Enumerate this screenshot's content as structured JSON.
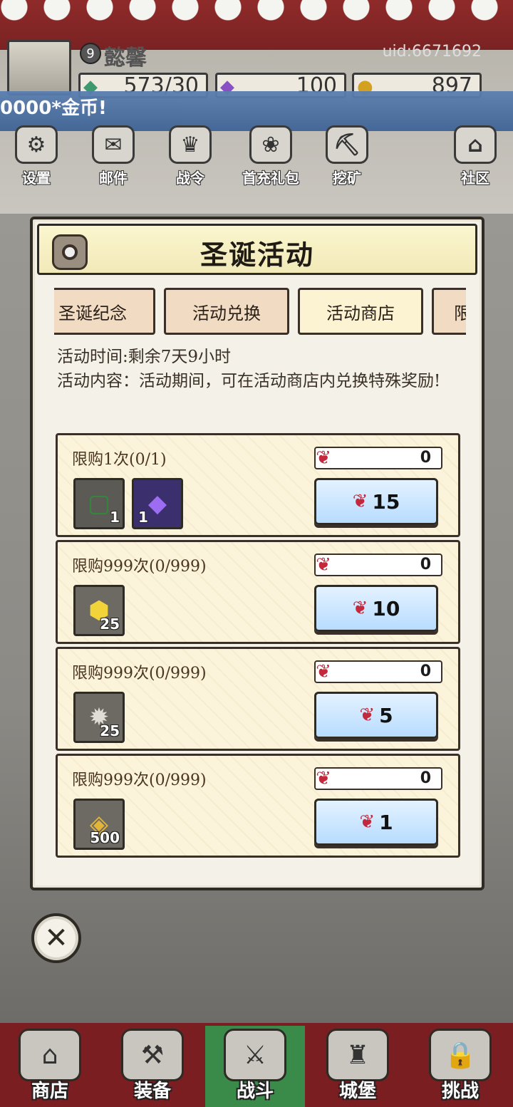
{
  "header": {
    "level": "9",
    "player_name": "懿馨",
    "uid": "uid:6671692",
    "resources": [
      {
        "icon": "green-gem-icon",
        "value": "573/30"
      },
      {
        "icon": "purple-diamond-icon",
        "value": "100"
      },
      {
        "icon": "gold-coin-icon",
        "value": "897"
      }
    ],
    "marquee": "0000*金币!"
  },
  "top_menu": [
    {
      "icon": "gear-icon",
      "label": "设置",
      "glyph": "⚙"
    },
    {
      "icon": "mail-icon",
      "label": "邮件",
      "glyph": "✉"
    },
    {
      "icon": "battle-pass-icon",
      "label": "战令",
      "glyph": "♛"
    },
    {
      "icon": "gift-bag-icon",
      "label": "首充礼包",
      "glyph": "❀"
    },
    {
      "icon": "mining-icon",
      "label": "挖矿",
      "glyph": "⛏"
    },
    {
      "icon": "community-icon",
      "label": "社区",
      "glyph": "⌂"
    }
  ],
  "dialog": {
    "title": "圣诞活动",
    "tabs": [
      {
        "label": "圣诞纪念",
        "active": false
      },
      {
        "label": "活动兑换",
        "active": false
      },
      {
        "label": "活动商店",
        "active": true
      },
      {
        "label": "限",
        "active": false
      }
    ],
    "time_text": "活动时间:剩余7天9小时",
    "content_text": "活动内容：活动期间，可在活动商店内兑换特殊奖励!",
    "items": [
      {
        "limit": "限购1次(0/1)",
        "owned": "0",
        "price": "15",
        "rewards": [
          {
            "icon": "christmas-frame-icon",
            "qty": "1",
            "glyph": "▢"
          },
          {
            "icon": "purple-crystal-icon",
            "qty": "1",
            "glyph": "◆"
          }
        ]
      },
      {
        "limit": "限购999次(0/999)",
        "owned": "0",
        "price": "10",
        "rewards": [
          {
            "icon": "gold-gem-icon",
            "qty": "25",
            "glyph": "⬢"
          }
        ]
      },
      {
        "limit": "限购999次(0/999)",
        "owned": "0",
        "price": "5",
        "rewards": [
          {
            "icon": "stone-ore-icon",
            "qty": "25",
            "glyph": "✹"
          }
        ]
      },
      {
        "limit": "限购999次(0/999)",
        "owned": "0",
        "price": "1",
        "rewards": [
          {
            "icon": "gold-coin-icon",
            "qty": "500",
            "glyph": "◈"
          }
        ]
      }
    ]
  },
  "bottom_nav": [
    {
      "icon": "shop-icon",
      "label": "商店",
      "glyph": "⌂",
      "active": false
    },
    {
      "icon": "backpack-icon",
      "label": "装备",
      "glyph": "⚒",
      "active": false
    },
    {
      "icon": "crossed-swords-icon",
      "label": "战斗",
      "glyph": "⚔",
      "active": true
    },
    {
      "icon": "castle-icon",
      "label": "城堡",
      "glyph": "♜",
      "active": false
    },
    {
      "icon": "lock-icon",
      "label": "挑战",
      "glyph": "🔒",
      "active": false
    }
  ],
  "colors": {
    "dialog_bg": "#f4f1e8",
    "tab_active": "#fbf3d2",
    "buy_button": "#b8dcff",
    "candy_red": "#c4283c",
    "nav_active": "#3a8a4a"
  }
}
